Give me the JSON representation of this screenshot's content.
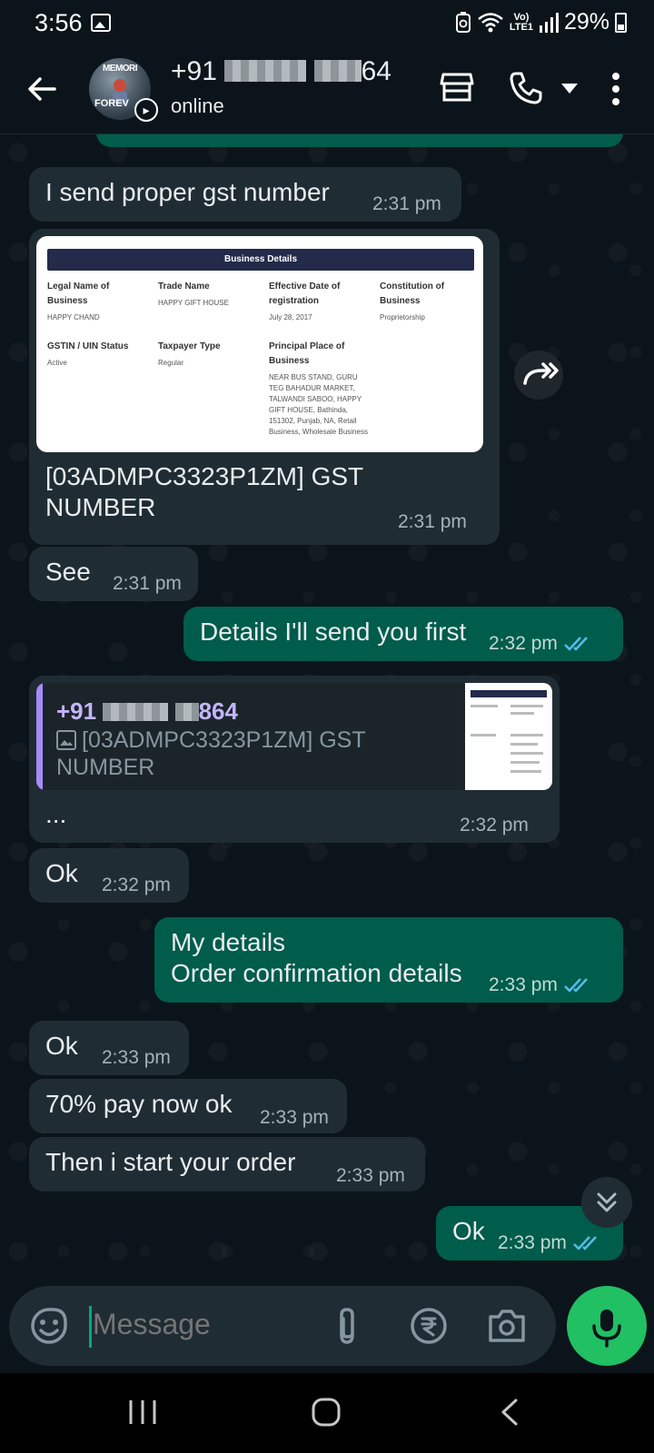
{
  "status_bar": {
    "time": "3:56",
    "network_top": "Vo)",
    "network_bottom": "LTE1",
    "battery": "29%"
  },
  "header": {
    "name_prefix": "+91",
    "name_suffix": "64",
    "status": "online",
    "avatar_text_top": "MEMORI",
    "avatar_text_bottom": "FOREV"
  },
  "messages": [
    {
      "dir": "in",
      "text": "I send proper gst number",
      "time": "2:31 pm"
    },
    {
      "dir": "in",
      "type": "document",
      "caption": "[03ADMPC3323P1ZM] GST NUMBER",
      "time": "2:31 pm"
    },
    {
      "dir": "in",
      "text": "See",
      "time": "2:31 pm"
    },
    {
      "dir": "out",
      "text": "Details I'll send you first",
      "time": "2:32 pm"
    },
    {
      "dir": "in",
      "type": "reply",
      "text": "...",
      "time": "2:32 pm"
    },
    {
      "dir": "in",
      "text": "Ok",
      "time": "2:32 pm"
    },
    {
      "dir": "out",
      "text_line1": "My details",
      "text_line2": "Order confirmation details",
      "time": "2:33 pm"
    },
    {
      "dir": "in",
      "text": "Ok",
      "time": "2:33 pm"
    },
    {
      "dir": "in",
      "text": "70% pay now ok",
      "time": "2:33 pm"
    },
    {
      "dir": "in",
      "text": "Then i start your order",
      "time": "2:33 pm"
    },
    {
      "dir": "out",
      "text": "Ok",
      "time": "2:33 pm"
    }
  ],
  "document": {
    "title": "Business Details",
    "fields": [
      {
        "label": "Legal Name of Business",
        "value": "HAPPY CHAND"
      },
      {
        "label": "Trade Name",
        "value": "HAPPY GIFT HOUSE"
      },
      {
        "label": "Effective Date of registration",
        "value": "July 28, 2017"
      },
      {
        "label": "Constitution of Business",
        "value": "Proprietorship"
      },
      {
        "label": "GSTIN / UIN Status",
        "value": "Active"
      },
      {
        "label": "Taxpayer Type",
        "value": "Regular"
      },
      {
        "label": "Principal Place of Business",
        "value": "NEAR BUS STAND, GURU TEG BAHADUR MARKET, TALWANDI SABOO, HAPPY GIFT HOUSE, Bathinda, 151302, Punjab, NA, Retail Business, Wholesale Business"
      }
    ]
  },
  "quote": {
    "name_prefix": "+91",
    "name_suffix": "864",
    "text": "[03ADMPC3323P1ZM] GST NUMBER"
  },
  "input": {
    "placeholder": "Message"
  },
  "icons": [
    "back-arrow-icon",
    "store-icon",
    "phone-icon",
    "dropdown-icon",
    "more-vert-icon",
    "forward-icon",
    "emoji-icon",
    "attach-icon",
    "rupee-icon",
    "camera-icon",
    "mic-icon",
    "double-chevron-down-icon",
    "double-tick-icon",
    "recents-icon",
    "home-icon",
    "nav-back-icon"
  ],
  "colors": {
    "background": "#0b141a",
    "incoming_bubble": "#202c33",
    "outgoing_bubble": "#005c4b",
    "accent_green": "#21c063",
    "read_ticks": "#53bdeb",
    "quote_accent": "#a78bfa"
  }
}
